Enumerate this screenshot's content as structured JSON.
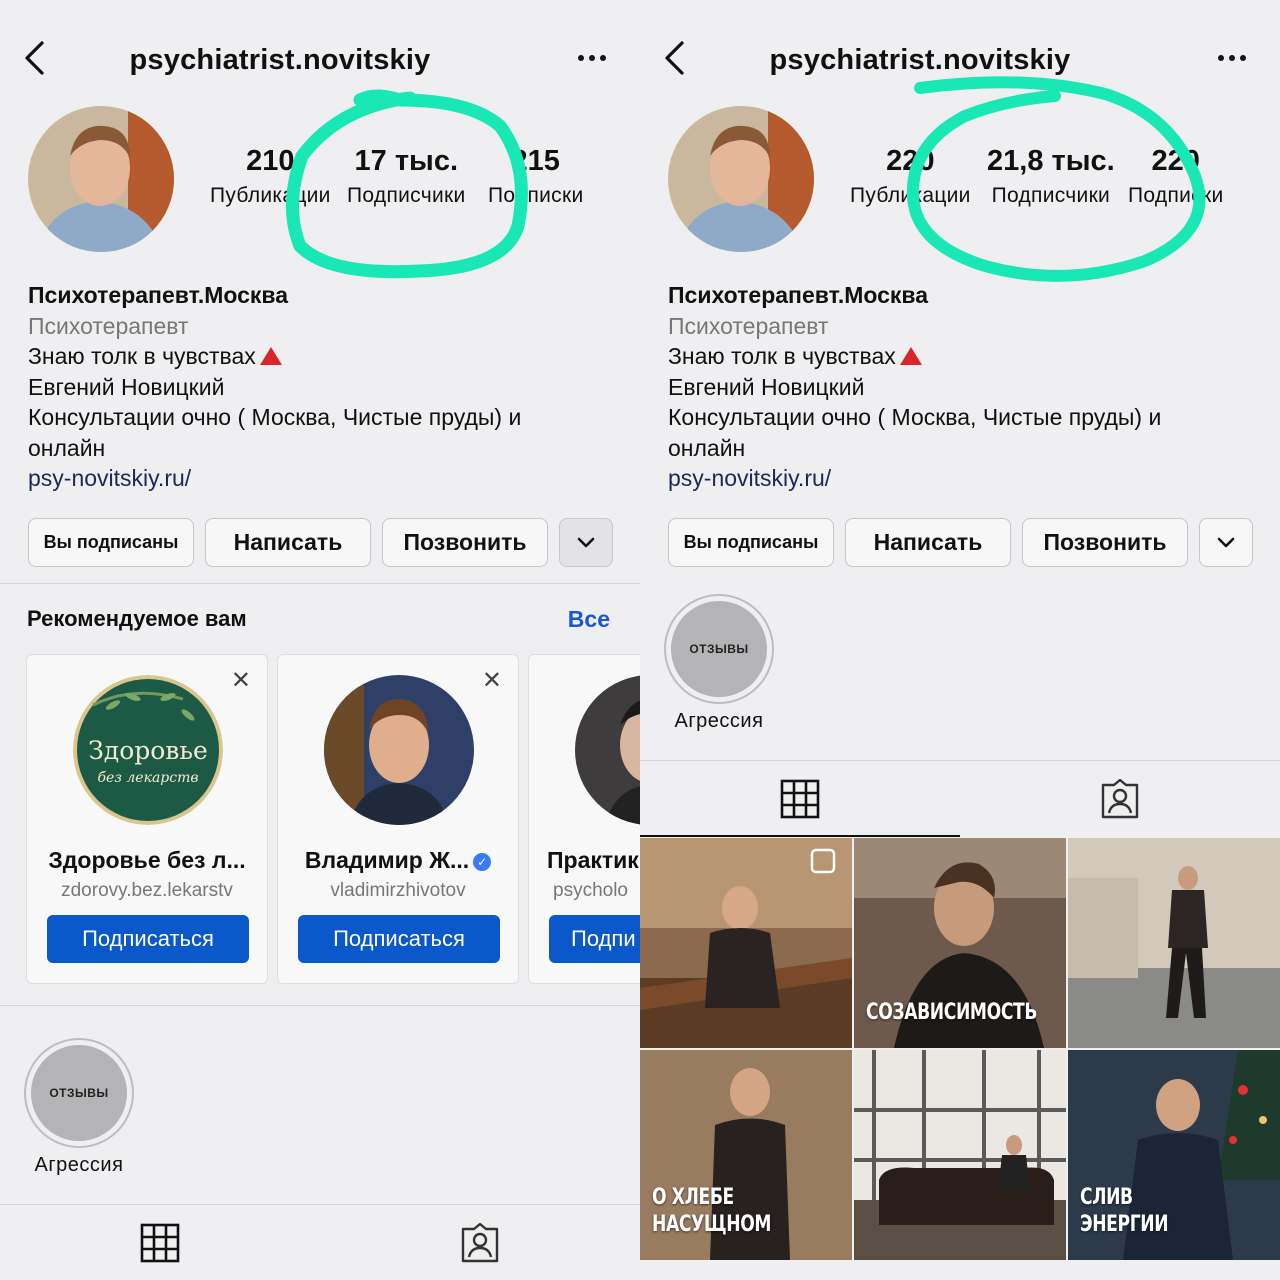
{
  "left": {
    "username": "psychiatrist.novitskiy",
    "stats": [
      {
        "value": "210",
        "label": "Публикации"
      },
      {
        "value": "17 тыс.",
        "label": "Подписчики"
      },
      {
        "value": "215",
        "label": "Подписки"
      }
    ],
    "bio": {
      "name": "Психотерапевт.Москва",
      "category": "Психотерапевт",
      "line1": "Знаю толк в чувствах",
      "line2": "Евгений Новицкий",
      "line3": "Консультации очно ( Москва, Чистые пруды) и",
      "line4": "онлайн",
      "link": "psy-novitskiy.ru/"
    },
    "actions": {
      "subscribed": "Вы подписаны",
      "message": "Написать",
      "call": "Позвонить"
    },
    "recommended": {
      "title": "Рекомендуемое вам",
      "all": "Все",
      "cards": [
        {
          "name": "Здоровье без л...",
          "handle": "zdorovy.bez.lekarstv",
          "button": "Подписаться",
          "avatar_title": "Здоровье",
          "avatar_subtitle": "без лекарств"
        },
        {
          "name": "Владимир Ж...",
          "handle": "vladimirzhivotov",
          "button": "Подписаться"
        },
        {
          "name": "Практик",
          "handle": "psycholo",
          "button": "Подпи"
        }
      ]
    },
    "highlight": {
      "cover_text": "ОТЗЫВЫ",
      "label": "Агрессия"
    }
  },
  "right": {
    "username": "psychiatrist.novitskiy",
    "stats": [
      {
        "value": "220",
        "label": "Публикации"
      },
      {
        "value": "21,8 тыс.",
        "label": "Подписчики"
      },
      {
        "value": "220",
        "label": "Подписки"
      }
    ],
    "bio": {
      "name": "Психотерапевт.Москва",
      "category": "Психотерапевт",
      "line1": "Знаю толк в чувствах",
      "line2": "Евгений Новицкий",
      "line3": "Консультации очно ( Москва, Чистые пруды) и",
      "line4": "онлайн",
      "link": "psy-novitskiy.ru/"
    },
    "actions": {
      "subscribed": "Вы подписаны",
      "message": "Написать",
      "call": "Позвонить"
    },
    "highlight": {
      "cover_text": "ОТЗЫВЫ",
      "label": "Агрессия"
    },
    "posts": [
      {
        "caption": ""
      },
      {
        "caption": "СОЗАВИСИМОСТЬ"
      },
      {
        "caption": ""
      },
      {
        "caption_line1": "О ХЛЕБЕ",
        "caption_line2": "НАСУЩНОМ"
      },
      {
        "caption": ""
      },
      {
        "caption_line1": "СЛИВ",
        "caption_line2": "ЭНЕРГИИ"
      }
    ]
  },
  "colors": {
    "annotation": "#19e8b4",
    "follow_button": "#0a58ca",
    "link": "#1a56d6",
    "alert_triangle": "#d9262a"
  },
  "icons": [
    "back-chevron-icon",
    "more-icon",
    "chevron-down-icon",
    "close-icon",
    "verified-icon",
    "grid-icon",
    "tagged-icon"
  ]
}
